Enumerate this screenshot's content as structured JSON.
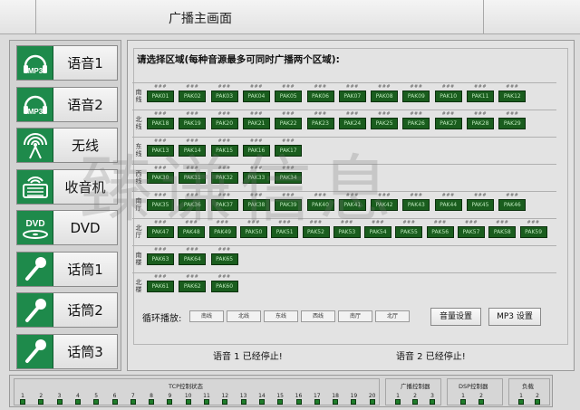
{
  "window": {
    "title": "广播主画面"
  },
  "sources": [
    {
      "icon": "mp3-icon",
      "label": "语音1",
      "tag": "MP3"
    },
    {
      "icon": "mp3-icon",
      "label": "语音2",
      "tag": "MP3"
    },
    {
      "icon": "wireless-icon",
      "label": "无线"
    },
    {
      "icon": "radio-icon",
      "label": "收音机"
    },
    {
      "icon": "dvd-icon",
      "label": "DVD",
      "tag": "DVD"
    },
    {
      "icon": "microphone-icon",
      "label": "话筒1"
    },
    {
      "icon": "microphone-icon",
      "label": "话筒2"
    },
    {
      "icon": "microphone-icon",
      "label": "话筒3"
    }
  ],
  "main": {
    "instruction": "请选择区域(每种音源最多可同时广播两个区域):",
    "placeholder_mark": "###",
    "zones": [
      {
        "name": "南线",
        "paks": [
          "PAK01",
          "PAK02",
          "PAK03",
          "PAK04",
          "PAK05",
          "PAK06",
          "PAK07",
          "PAK08",
          "PAK09",
          "PAK10",
          "PAK11",
          "PAK12"
        ]
      },
      {
        "name": "北线",
        "paks": [
          "PAK18",
          "PAK19",
          "PAK20",
          "PAK21",
          "PAK22",
          "PAK23",
          "PAK24",
          "PAK25",
          "PAK26",
          "PAK27",
          "PAK28",
          "PAK29"
        ]
      },
      {
        "name": "东线",
        "paks": [
          "PAK13",
          "PAK14",
          "PAK15",
          "PAK16",
          "PAK17"
        ]
      },
      {
        "name": "西线",
        "paks": [
          "PAK30",
          "PAK31",
          "PAK32",
          "PAK33",
          "PAK34"
        ]
      },
      {
        "name": "南厅",
        "paks": [
          "PAK35",
          "PAK36",
          "PAK37",
          "PAK38",
          "PAK39",
          "PAK40",
          "PAK41",
          "PAK42",
          "PAK43",
          "PAK44",
          "PAK45",
          "PAK46"
        ]
      },
      {
        "name": "北厅",
        "paks": [
          "PAK47",
          "PAK48",
          "PAK49",
          "PAK50",
          "PAK51",
          "PAK52",
          "PAK53",
          "PAK54",
          "PAK55",
          "PAK56",
          "PAK57",
          "PAK58",
          "PAK59"
        ]
      },
      {
        "name": "南楼",
        "paks": [
          "PAK63",
          "PAK64",
          "PAK65"
        ]
      },
      {
        "name": "北楼",
        "paks": [
          "PAK61",
          "PAK62",
          "PAK60"
        ]
      }
    ],
    "loop_label": "循环播放:",
    "loop_buttons": [
      "南线",
      "北线",
      "东线",
      "西线",
      "南厅",
      "北厅"
    ],
    "volume_button": "音量设置",
    "mp3_button": "MP3 设置",
    "status1": "语音 1 已经停止!",
    "status2": "语音 2 已经停止!"
  },
  "bottom": {
    "tcp_title": "TCP控制状态",
    "tcp": [
      "1",
      "2",
      "3",
      "4",
      "5",
      "6",
      "7",
      "8",
      "9",
      "10",
      "11",
      "12",
      "13",
      "14",
      "15",
      "16",
      "17",
      "18",
      "19",
      "20"
    ],
    "broadcast_title": "广播控制器",
    "broadcast": [
      "1",
      "2",
      "3"
    ],
    "dsp_title": "DSP控制器",
    "dsp": [
      "1",
      "2"
    ],
    "load_title": "负载",
    "load": [
      "1",
      "2"
    ]
  },
  "watermark": "臻谦信息",
  "colors": {
    "icon_green": "#1e8a4b",
    "pak_green": "#1a5d1e",
    "indicator_green": "#1f7d2a"
  }
}
